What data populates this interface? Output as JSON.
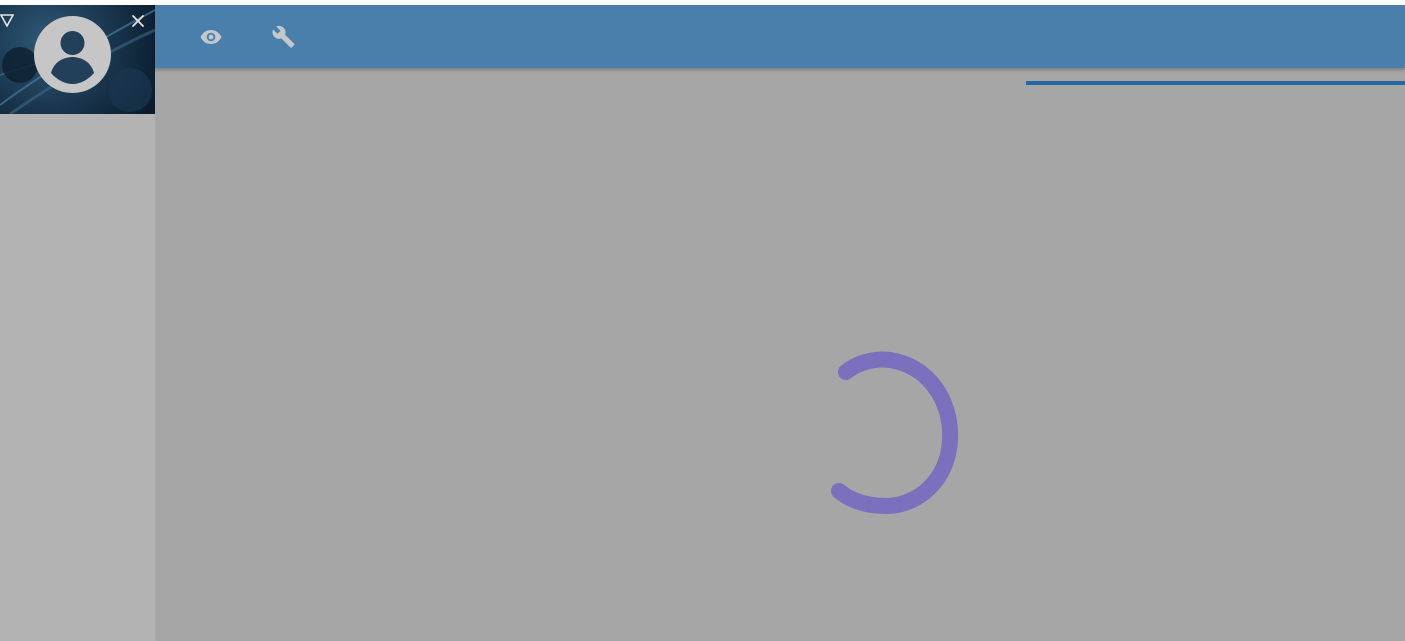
{
  "sidebar": {
    "header": {
      "avatar_icon": "account-circle-icon",
      "dropdown_icon": "triangle-down-outline-icon",
      "close_icon": "close-icon"
    }
  },
  "toolbar": {
    "buttons": [
      {
        "name": "view",
        "icon": "eye-icon"
      },
      {
        "name": "tools",
        "icon": "wrench-icon"
      }
    ]
  },
  "loading": {
    "state": "loading",
    "spinner_icon": "circular-progress-spinner"
  },
  "colors": {
    "toolbar_bg": "#4a7fac",
    "overlay_bg": "#a6a6a6",
    "sidebar_bg": "#b3b3b3",
    "tab_indicator": "#2666a1",
    "spinner": "#7b70bd",
    "toolbar_icons": "#c4c8cc"
  }
}
